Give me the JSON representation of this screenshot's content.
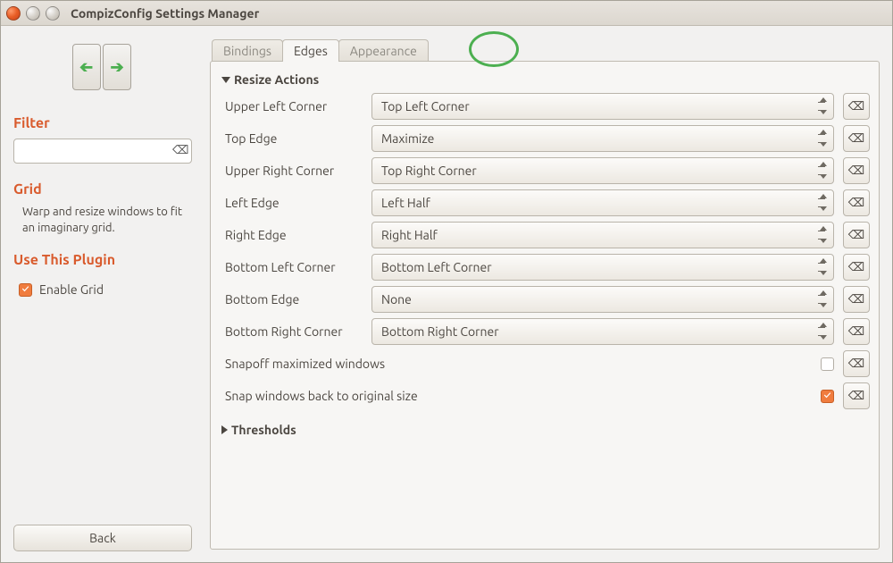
{
  "window": {
    "title": "CompizConfig Settings Manager"
  },
  "sidebar": {
    "filter_heading": "Filter",
    "filter_value": "",
    "plugin_name": "Grid",
    "plugin_desc": "Warp and resize windows to fit an imaginary grid.",
    "use_heading": "Use This Plugin",
    "enable_label": "Enable Grid",
    "enable_checked": true,
    "back_label": "Back"
  },
  "tabs": {
    "items": [
      "Bindings",
      "Edges",
      "Appearance"
    ],
    "active": 1
  },
  "groups": {
    "resize_actions": {
      "title": "Resize Actions",
      "expanded": true,
      "rows": [
        {
          "label": "Upper Left Corner",
          "value": "Top Left Corner"
        },
        {
          "label": "Top Edge",
          "value": "Maximize"
        },
        {
          "label": "Upper Right Corner",
          "value": "Top Right Corner"
        },
        {
          "label": "Left Edge",
          "value": "Left Half"
        },
        {
          "label": "Right Edge",
          "value": "Right Half"
        },
        {
          "label": "Bottom Left Corner",
          "value": "Bottom Left Corner"
        },
        {
          "label": "Bottom Edge",
          "value": "None"
        },
        {
          "label": "Bottom Right Corner",
          "value": "Bottom Right Corner"
        }
      ],
      "checks": [
        {
          "label": "Snapoff maximized windows",
          "checked": false
        },
        {
          "label": "Snap windows back to original size",
          "checked": true
        }
      ]
    },
    "thresholds": {
      "title": "Thresholds",
      "expanded": false
    }
  }
}
